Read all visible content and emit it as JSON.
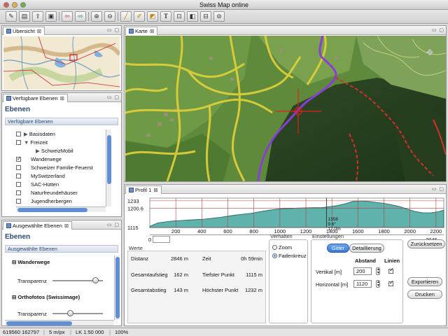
{
  "window": {
    "title": "Swiss Map online"
  },
  "toolbar": {
    "text_tool_glyph": "T"
  },
  "overview": {
    "tab": "Übersicht"
  },
  "layers": {
    "tab": "Verfügbare Ebenen",
    "title": "Ebenen",
    "section": "Verfügbare Ebenen",
    "items": [
      {
        "label": "Basisdaten",
        "checked": false
      },
      {
        "label": "Freizeit",
        "checked": false
      },
      {
        "label": "SchweizMobil",
        "checked": false
      },
      {
        "label": "Wanderwege",
        "checked": true
      },
      {
        "label": "Schweizer Familie-Feuerst",
        "checked": false
      },
      {
        "label": "MySwitzerland",
        "checked": false
      },
      {
        "label": "SAC-Hütten",
        "checked": false
      },
      {
        "label": "Naturfreundehäuser",
        "checked": false
      },
      {
        "label": "Jugendherbergen",
        "checked": false
      }
    ]
  },
  "selected_layers": {
    "tab": "Ausgewählte Ebenen",
    "title": "Ebenen",
    "section": "Ausgewählte Ebenen",
    "groups": [
      {
        "label": "Wanderwege",
        "transparency_label": "Transparenz",
        "transparency": 0.85
      },
      {
        "label": "Orthofotos (Swissimage)",
        "transparency_label": "Transparenz",
        "transparency": 0.35
      }
    ]
  },
  "map": {
    "tab": "Karte"
  },
  "profile": {
    "tab": "Profil 1",
    "y_ticks": [
      "1233",
      "1200.6",
      "1115"
    ],
    "x_ticks": [
      "200",
      "400",
      "600",
      "800",
      "1000",
      "1200",
      "1400",
      "1600",
      "1800",
      "2000",
      "2200"
    ],
    "range_start": "0",
    "range_end": "2846",
    "cursor": {
      "line1": "1358",
      "line2": "9.6°",
      "line3": "17.0%"
    },
    "chart_data": {
      "type": "area",
      "xlabel": "",
      "ylabel": "",
      "xlim": [
        0,
        2260
      ],
      "ylim": [
        1115,
        1245
      ],
      "x": [
        0,
        60,
        120,
        180,
        240,
        300,
        360,
        420,
        480,
        540,
        600,
        660,
        720,
        780,
        840,
        900,
        960,
        1020,
        1080,
        1140,
        1200,
        1260,
        1320,
        1380,
        1440,
        1500,
        1560,
        1620,
        1680,
        1740,
        1800,
        1860,
        1920,
        1980,
        2040,
        2100,
        2160,
        2220,
        2260
      ],
      "y": [
        1120,
        1135,
        1140,
        1144,
        1146,
        1148,
        1150,
        1152,
        1156,
        1160,
        1165,
        1170,
        1174,
        1178,
        1184,
        1190,
        1195,
        1198,
        1199,
        1201,
        1202,
        1203,
        1203,
        1207,
        1212,
        1220,
        1230,
        1233,
        1230,
        1226,
        1222,
        1215,
        1208,
        1196,
        1186,
        1180,
        1180,
        1185,
        1192
      ]
    }
  },
  "werte": {
    "title": "Werte",
    "rows": [
      {
        "label1": "Distanz",
        "value1": "2846 m",
        "label2": "Zeit",
        "value2": "0h 59min"
      },
      {
        "label1": "Gesamtaufstieg",
        "value1": "162 m",
        "label2": "Tiefster Punkt",
        "value2": "1115 m"
      },
      {
        "label1": "Gesamtabstieg",
        "value1": "143 m",
        "label2": "Höchster Punkt",
        "value2": "1232 m"
      }
    ]
  },
  "verhalten": {
    "title": "Verhalten",
    "options": [
      {
        "label": "Zoom",
        "selected": false
      },
      {
        "label": "Fadenkreuz",
        "selected": true
      }
    ]
  },
  "einstellungen": {
    "title": "Einstellungen",
    "tab_gitter": "Gitter",
    "tab_detail": "Detaillierung",
    "col_abstand": "Abstand",
    "col_linien": "Linien",
    "vertikal_label": "Vertikal [m]",
    "vertikal_value": "200",
    "vertikal_lines": true,
    "horizontal_label": "Horizontal [m]",
    "horizontal_value": "1120",
    "horizontal_lines": true
  },
  "actions": {
    "reset": "Zurücksetzen",
    "export": "Exportieren",
    "print": "Drucken"
  },
  "status": {
    "coords": "619560 162797",
    "resolution": "5 m/px",
    "scale": "LK 1:50 000",
    "zoom": "100%"
  }
}
